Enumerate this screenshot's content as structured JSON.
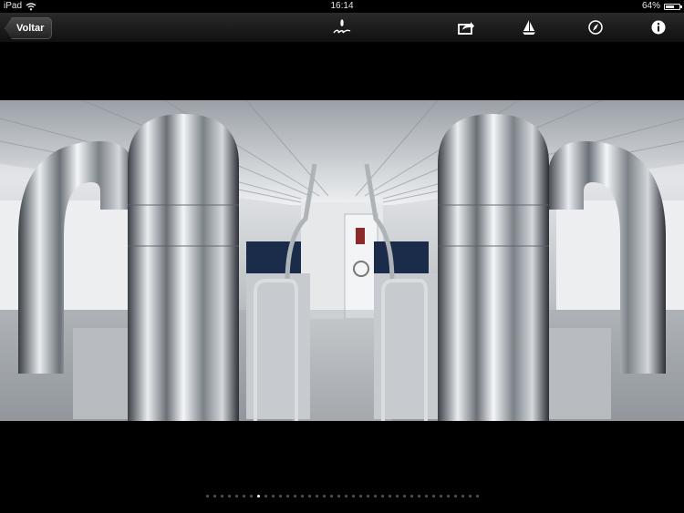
{
  "status_bar": {
    "device": "iPad",
    "time": "16:14",
    "battery": "64%",
    "battery_level": 0.64,
    "wifi_icon": "wifi-icon",
    "battery_icon": "battery-icon"
  },
  "nav_bar": {
    "back_label": "Voltar",
    "logo_icon": "brand-logo-icon",
    "share_icon": "share-icon",
    "sailboat_icon": "sailboat-icon",
    "compass_icon": "compass-icon",
    "info_icon": "info-icon"
  },
  "gallery": {
    "photo_subject": "engine room",
    "page_count": 38,
    "current_page": 8,
    "colors": {
      "active_dot": "#ffffff",
      "inactive_dot": "#555555"
    }
  }
}
